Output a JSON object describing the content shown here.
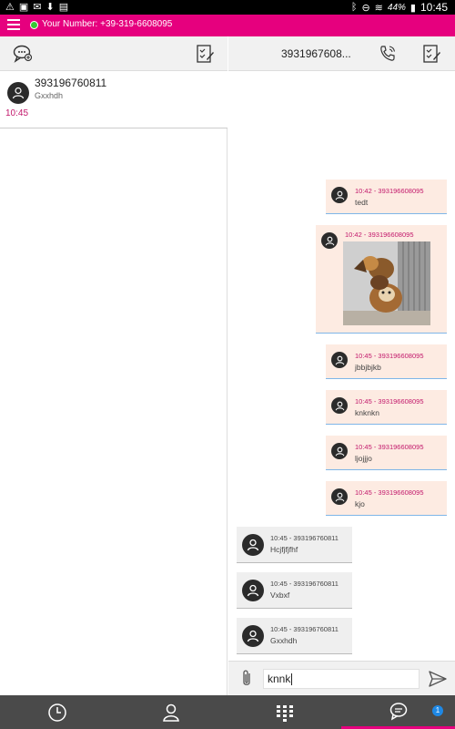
{
  "status_bar": {
    "battery_pct": "44%",
    "time": "10:45",
    "notification_icons": [
      "warning-icon",
      "image-icon",
      "gmail-icon",
      "download-icon",
      "briefcase-icon"
    ]
  },
  "app_bar": {
    "your_number_label": "Your Number: +39-319-6608095",
    "status_color": "#35c934",
    "accent": "#e6007e"
  },
  "conversations": [
    {
      "name": "393196760811",
      "preview": "Gxxhdh",
      "time": "10:45"
    }
  ],
  "chat": {
    "title": "3931967608...",
    "messages": [
      {
        "dir": "out",
        "meta": "10:42 - 393196608095",
        "text": "tedt"
      },
      {
        "dir": "out",
        "meta": "10:42 - 393196608095",
        "text": "",
        "image": "dog-photo"
      },
      {
        "dir": "out",
        "meta": "10:45 - 393196608095",
        "text": "jbbjbjkb"
      },
      {
        "dir": "out",
        "meta": "10:45 - 393196608095",
        "text": "knknkn"
      },
      {
        "dir": "out",
        "meta": "10:45 - 393196608095",
        "text": "ljojjjo"
      },
      {
        "dir": "out",
        "meta": "10:45 - 393196608095",
        "text": "kjo"
      },
      {
        "dir": "in",
        "meta": "10:45 - 393196760811",
        "text": "Hcjfjfjfhf"
      },
      {
        "dir": "in",
        "meta": "10:45 - 393196760811",
        "text": "Vxbxf"
      },
      {
        "dir": "in",
        "meta": "10:45 - 393196760811",
        "text": "Gxxhdh"
      }
    ],
    "composer_value": "knnk"
  },
  "bottom_nav": {
    "items": [
      "history-icon",
      "contacts-icon",
      "dialpad-icon",
      "chat-icon"
    ],
    "active": "chat-icon",
    "chat_badge": "1"
  }
}
